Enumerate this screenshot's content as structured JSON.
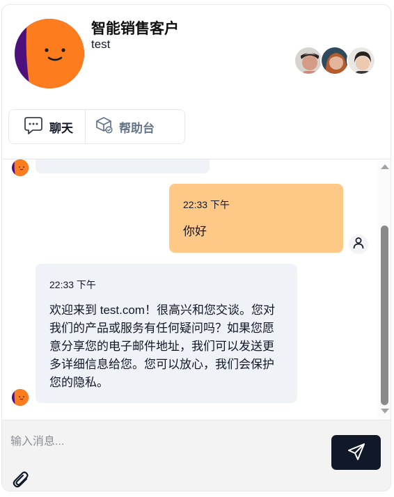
{
  "header": {
    "title": "智能销售客户",
    "subtitle": "test"
  },
  "tabs": [
    {
      "label": "聊天",
      "icon": "chat-bubble-icon",
      "active": true
    },
    {
      "label": "帮助台",
      "icon": "helpdesk-box-icon",
      "active": false
    }
  ],
  "messages": [
    {
      "sender": "user",
      "time": "22:33 下午",
      "text": "你好"
    },
    {
      "sender": "bot",
      "time": "22:33 下午",
      "text": "欢迎来到 test.com！很高兴和您交谈。您对我们的产品或服务有任何疑问吗？如果您愿意分享您的电子邮件地址，我们可以发送更多详细信息给您。您可以放心，我们会保护您的隐私。"
    }
  ],
  "composer": {
    "placeholder": "输入消息..."
  },
  "colors": {
    "brand_orange": "#fd7c1e",
    "brand_purple": "#4c117c",
    "user_bubble": "#fec886",
    "bot_bubble": "#eff2f7",
    "send_button": "#111827"
  }
}
